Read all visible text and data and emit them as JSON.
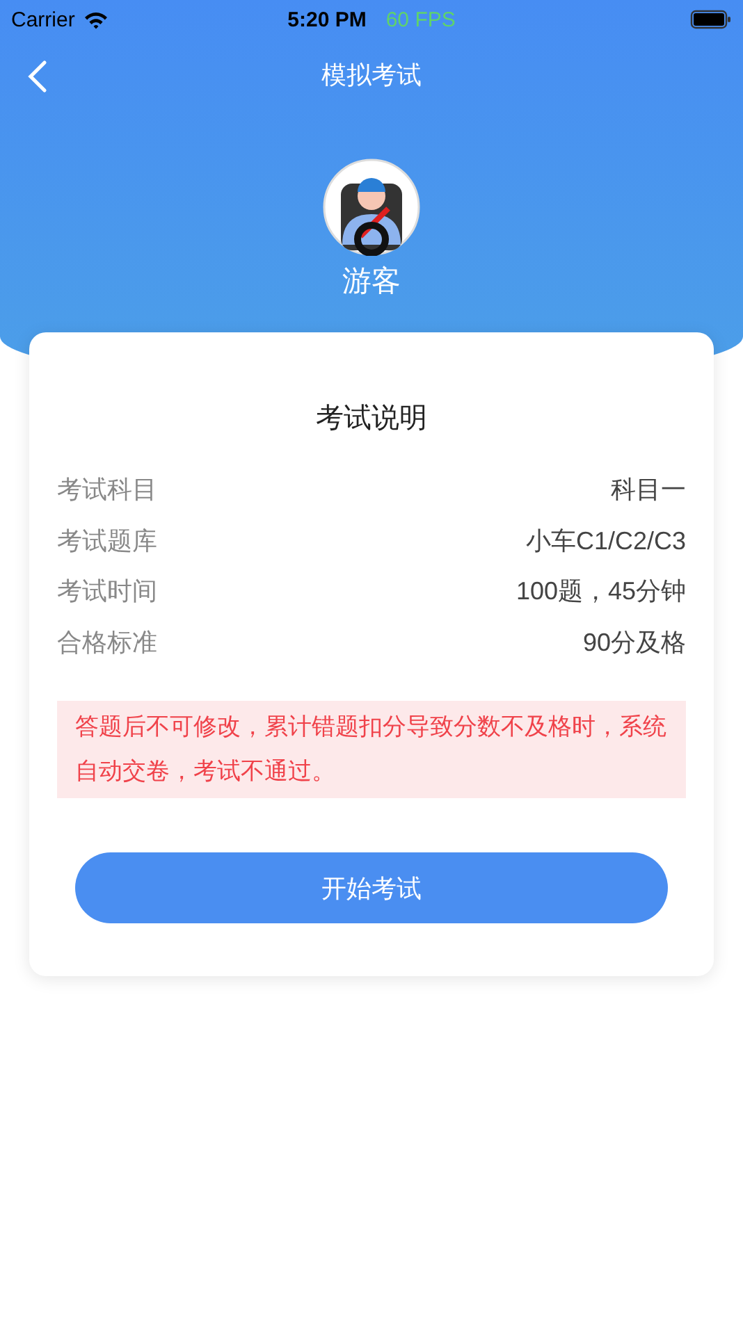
{
  "status_bar": {
    "carrier": "Carrier",
    "time": "5:20 PM",
    "fps": "60 FPS"
  },
  "nav": {
    "title": "模拟考试"
  },
  "user": {
    "name": "游客"
  },
  "card": {
    "title": "考试说明",
    "rows": [
      {
        "label": "考试科目",
        "value": "科目一"
      },
      {
        "label": "考试题库",
        "value": "小车C1/C2/C3"
      },
      {
        "label": "考试时间",
        "value": "100题，45分钟"
      },
      {
        "label": "合格标准",
        "value": "90分及格"
      }
    ],
    "notice": "答题后不可修改，累计错题扣分导致分数不及格时，系统自动交卷，考试不通过。",
    "button": "开始考试"
  }
}
